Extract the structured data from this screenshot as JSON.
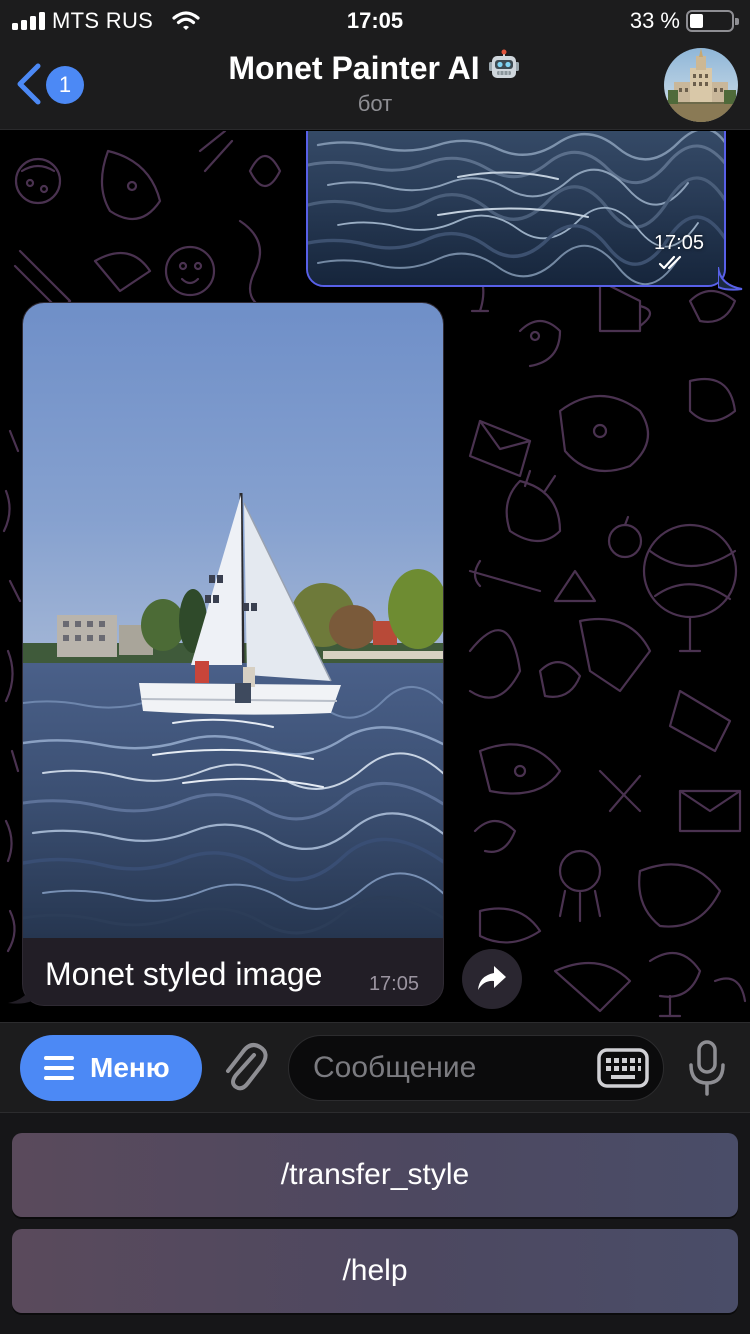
{
  "status_bar": {
    "carrier": "MTS RUS",
    "time": "17:05",
    "battery_percent_text": "33 %",
    "battery_level": 0.33,
    "icons": [
      "signal-icon",
      "wifi-icon",
      "battery-icon"
    ]
  },
  "header": {
    "back_icon": "chevron-left-icon",
    "unread_count": "1",
    "title": "Monet Painter AI",
    "title_emoji_icon": "robot-face-icon",
    "subtitle": "бот",
    "avatar": "building-photo-avatar"
  },
  "messages": [
    {
      "direction": "outgoing",
      "kind": "photo",
      "photo": "water-surface-photo",
      "time": "17:05",
      "status_icon": "double-check-icon"
    },
    {
      "direction": "incoming",
      "kind": "photo",
      "photo": "sailboat-monet-styled-photo",
      "caption": "Monet styled image",
      "time": "17:05",
      "action_icon": "share-forward-icon"
    }
  ],
  "input_bar": {
    "menu_label": "Меню",
    "menu_icon": "hamburger-icon",
    "attach_icon": "paperclip-icon",
    "placeholder": "Сообщение",
    "keyboard_icon": "keyboard-icon",
    "mic_icon": "microphone-icon"
  },
  "bot_keyboard": {
    "buttons": [
      "/transfer_style",
      "/help"
    ]
  },
  "colors": {
    "accent": "#4c89f5",
    "outgoing_border": "#5860e8",
    "bar_background": "#1c1c1d",
    "wallpaper_doodle": "#4a3250"
  }
}
